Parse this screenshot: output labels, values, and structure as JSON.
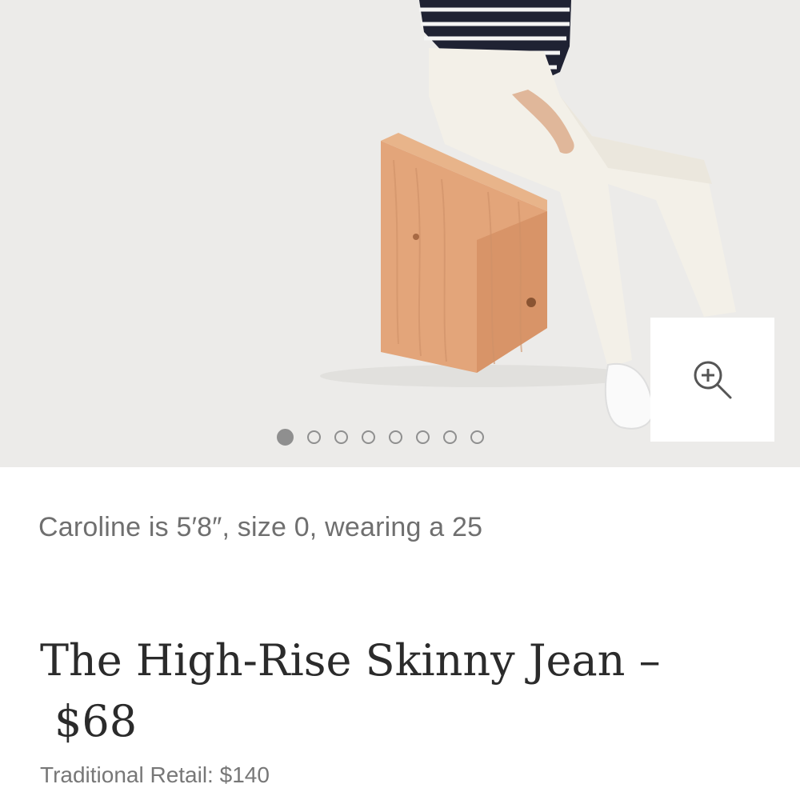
{
  "product_image": {
    "carousel": {
      "total": 8,
      "active_index": 0
    },
    "zoom_icon": "zoom-in-icon"
  },
  "details": {
    "model_note": "Caroline is 5′8″, size 0, wearing a 25",
    "title": "The High-Rise Skinny Jean –",
    "price": "$68",
    "traditional_retail_label": "Traditional Retail: $140"
  },
  "colors": {
    "hero_background": "#ecebe9",
    "dot": "#8f8f8f",
    "title_text": "#2b2b2b",
    "muted_text": "#6f6f6f"
  }
}
